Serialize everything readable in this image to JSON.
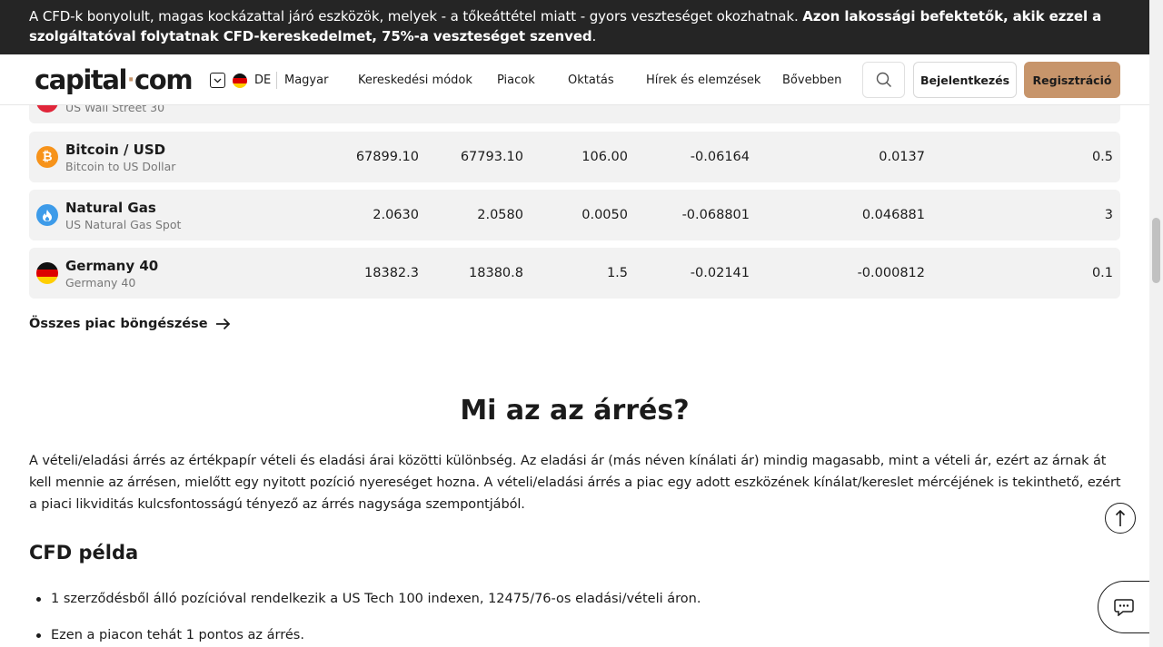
{
  "risk_banner": {
    "text": "A CFD-k bonyolult, magas kockázattal járó eszközök, melyek - a tőkeáttétel miatt - gyors veszteséget okozhatnak. ",
    "bold_text": "Azon lakossági befektetők, akik ezzel a szolgáltatóval folytatnak CFD-kereskedelmet, 75%-a veszteséget szenved",
    "trailing": "."
  },
  "header": {
    "logo_left": "capital",
    "logo_dot": "·",
    "logo_right": "com",
    "lang_code": "DE",
    "lang_name": "Magyar",
    "nav": [
      "Kereskedési módok",
      "Piacok",
      "Oktatás",
      "Hírek és elemzések",
      "Bővebben"
    ],
    "login_label": "Bejelentkezés",
    "register_label": "Regisztráció"
  },
  "markets": {
    "partial_row_sub": "US Wall Street 30",
    "rows": [
      {
        "name": "Bitcoin / USD",
        "sub": "Bitcoin to US Dollar",
        "sell": "67899.10",
        "buy": "67793.10",
        "spread": "106.00",
        "overnight_long": "-0.06164",
        "overnight_short": "0.0137",
        "margin": "0.5",
        "icon": "bitcoin-icon"
      },
      {
        "name": "Natural Gas",
        "sub": "US Natural Gas Spot",
        "sell": "2.0630",
        "buy": "2.0580",
        "spread": "0.0050",
        "overnight_long": "-0.068801",
        "overnight_short": "0.046881",
        "margin": "3",
        "icon": "flame-icon"
      },
      {
        "name": "Germany 40",
        "sub": "Germany 40",
        "sell": "18382.3",
        "buy": "18380.8",
        "spread": "1.5",
        "overnight_long": "-0.02141",
        "overnight_short": "-0.000812",
        "margin": "0.1",
        "icon": "germany-flag-icon"
      }
    ],
    "browse_label": "Összes piac böngészése"
  },
  "article": {
    "title": "Mi az az árrés?",
    "paragraph": "A vételi/eladási árrés az értékpapír vételi és eladási árai közötti különbség. Az eladási ár (más néven kínálati ár) mindig magasabb, mint a vételi ár, ezért az árnak át kell mennie az árrésen, mielőtt egy nyitott pozíció nyereséget hozna. A vételi/eladási árrés a piac egy adott eszközének kínálat/kereslet mércéjének is tekinthető, ezért a piaci likviditás kulcsfontosságú tényező az árrés nagysága szempontjából.",
    "example_heading": "CFD példa",
    "bullets": [
      "1 szerződésből álló pozícióval rendelkezik a US Tech 100 indexen, 12475/76-os eladási/vételi áron.",
      "Ezen a piacon tehát 1 pontos az árrés."
    ]
  },
  "colors": {
    "accent": "#c7956b",
    "banner_bg": "#252525",
    "row_bg": "#f2f2f2",
    "bitcoin": "#f7931a",
    "gas": "#3d9be9"
  }
}
